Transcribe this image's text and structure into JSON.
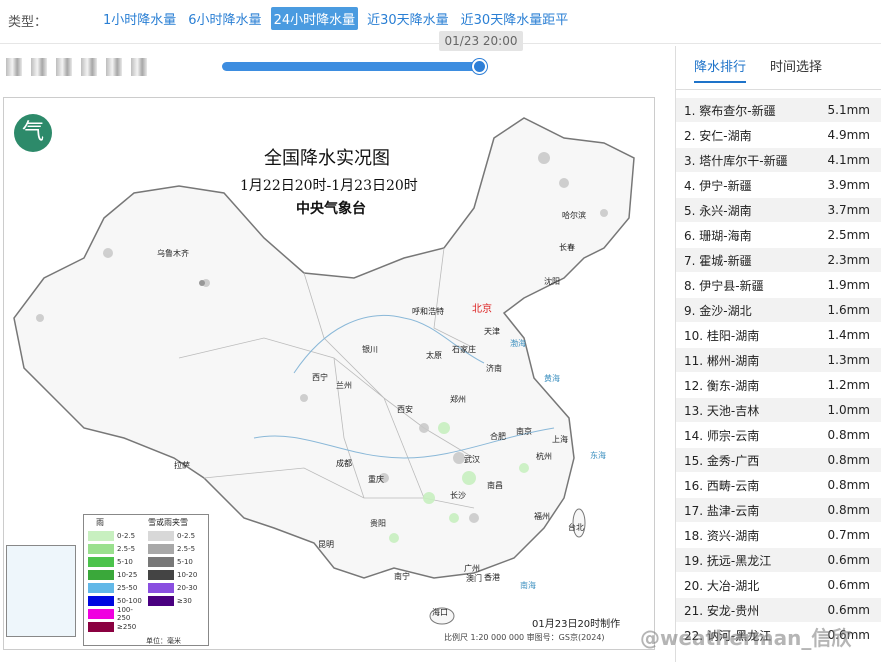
{
  "topbar": {
    "type_label": "类型：",
    "tabs": [
      {
        "label": "1小时降水量"
      },
      {
        "label": "6小时降水量"
      },
      {
        "label": "24小时降水量"
      },
      {
        "label": "近30天降水量"
      },
      {
        "label": "近30天降水量距平"
      }
    ],
    "active_tab": "24小时降水量",
    "time_tooltip": "01/23 20:00",
    "slider_progress": 1.0
  },
  "map": {
    "title": "全国降水实况图",
    "subtitle": "1月22日20时-1月23日20时",
    "org": "中央气象台",
    "logo_glyph": "气",
    "made_text": "01月23日20时制作",
    "scale_text": "比例尺 1:20 000 000    审图号：GS京(2024)",
    "cities": {
      "urumqi": "乌鲁木齐",
      "harbin": "哈尔滨",
      "changchun": "长春",
      "shenyang": "沈阳",
      "hohhot": "呼和浩特",
      "beijing": "北京",
      "tianjin": "天津",
      "yinchuan": "银川",
      "taiyuan": "太原",
      "shijiazhuang": "石家庄",
      "jinan": "济南",
      "xining": "西宁",
      "lanzhou": "兰州",
      "xian": "西安",
      "zhengzhou": "郑州",
      "hefei": "合肥",
      "nanjing": "南京",
      "shanghai": "上海",
      "lhasa": "拉萨",
      "chengdu": "成都",
      "chongqing": "重庆",
      "wuhan": "武汉",
      "hangzhou": "杭州",
      "changsha": "长沙",
      "nanchang": "南昌",
      "fuzhou": "福州",
      "taibei": "台北",
      "guiyang": "贵阳",
      "kunming": "昆明",
      "nanning": "南宁",
      "guangzhou": "广州",
      "hongkong": "香港",
      "macau": "澳门",
      "haikou": "海口"
    },
    "seas": {
      "bohai": "渤海",
      "huanghai": "黄海",
      "donghai": "东海",
      "nanhai": "南海"
    },
    "legend": {
      "rain_head": "雨",
      "snow_head": "雪或雨夹雪",
      "unit": "单位：毫米",
      "rain": [
        {
          "label": "0-2.5",
          "color": "#c8f0c0"
        },
        {
          "label": "2.5-5",
          "color": "#9ae08e"
        },
        {
          "label": "5-10",
          "color": "#4cc34c"
        },
        {
          "label": "10-25",
          "color": "#3aa83a"
        },
        {
          "label": "25-50",
          "color": "#62b8e8"
        },
        {
          "label": "50-100",
          "color": "#0008e0"
        },
        {
          "label": "100-250",
          "color": "#f000e0"
        },
        {
          "label": "≥250",
          "color": "#8a0040"
        }
      ],
      "snow": [
        {
          "label": "0-2.5",
          "color": "#d8d8d8"
        },
        {
          "label": "2.5-5",
          "color": "#a8a8a8"
        },
        {
          "label": "5-10",
          "color": "#787878"
        },
        {
          "label": "10-20",
          "color": "#444444"
        },
        {
          "label": "20-30",
          "color": "#8a4fe0"
        },
        {
          "label": "≥30",
          "color": "#4a0080"
        }
      ]
    }
  },
  "panel": {
    "tabs": [
      {
        "label": "降水排行"
      },
      {
        "label": "时间选择"
      }
    ],
    "ranking": [
      {
        "name": "1. 察布查尔-新疆",
        "value": "5.1mm"
      },
      {
        "name": "2. 安仁-湖南",
        "value": "4.9mm"
      },
      {
        "name": "3. 塔什库尔干-新疆",
        "value": "4.1mm"
      },
      {
        "name": "4. 伊宁-新疆",
        "value": "3.9mm"
      },
      {
        "name": "5. 永兴-湖南",
        "value": "3.7mm"
      },
      {
        "name": "6. 珊瑚-海南",
        "value": "2.5mm"
      },
      {
        "name": "7. 霍城-新疆",
        "value": "2.3mm"
      },
      {
        "name": "8. 伊宁县-新疆",
        "value": "1.9mm"
      },
      {
        "name": "9. 金沙-湖北",
        "value": "1.6mm"
      },
      {
        "name": "10. 桂阳-湖南",
        "value": "1.4mm"
      },
      {
        "name": "11. 郴州-湖南",
        "value": "1.3mm"
      },
      {
        "name": "12. 衡东-湖南",
        "value": "1.2mm"
      },
      {
        "name": "13. 天池-吉林",
        "value": "1.0mm"
      },
      {
        "name": "14. 师宗-云南",
        "value": "0.8mm"
      },
      {
        "name": "15. 金秀-广西",
        "value": "0.8mm"
      },
      {
        "name": "16. 西畴-云南",
        "value": "0.8mm"
      },
      {
        "name": "17. 盐津-云南",
        "value": "0.8mm"
      },
      {
        "name": "18. 资兴-湖南",
        "value": "0.7mm"
      },
      {
        "name": "19. 抚远-黑龙江",
        "value": "0.6mm"
      },
      {
        "name": "20. 大冶-湖北",
        "value": "0.6mm"
      },
      {
        "name": "21. 安龙-贵州",
        "value": "0.6mm"
      },
      {
        "name": "22. 讷河-黑龙江",
        "value": "0.6mm"
      }
    ]
  },
  "watermark": "@weatherman_信欣"
}
